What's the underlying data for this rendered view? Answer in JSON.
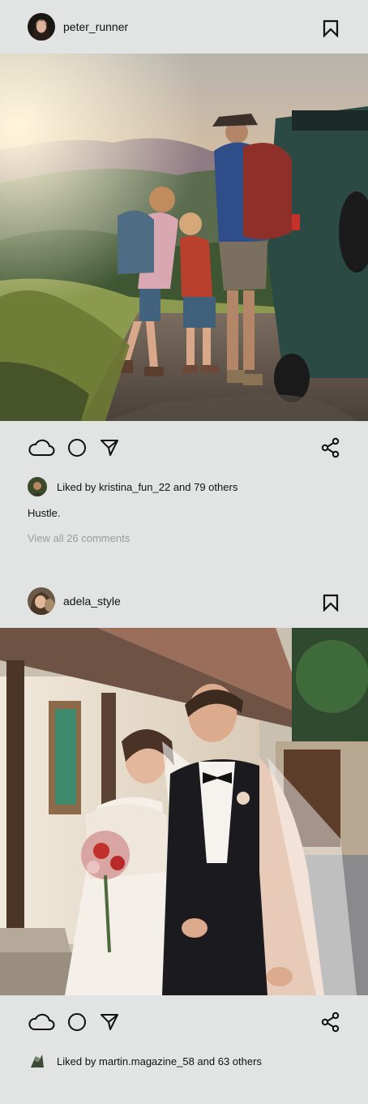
{
  "posts": [
    {
      "username": "peter_runner",
      "liked_by_text": "Liked by kristina_fun_22 and 79 others",
      "caption": "Hustle.",
      "comments_link": "View all 26 comments"
    },
    {
      "username": "adela_style",
      "liked_by_text": "Liked by martin.magazine_58 and 63 others"
    }
  ],
  "icons": {
    "like": "cloud-icon",
    "comment": "circle-icon",
    "send": "send-icon",
    "share": "share-icon",
    "bookmark": "bookmark-icon"
  },
  "colors": {
    "background": "#e1e4e3",
    "text": "#111111",
    "muted": "#9a9d9d"
  }
}
